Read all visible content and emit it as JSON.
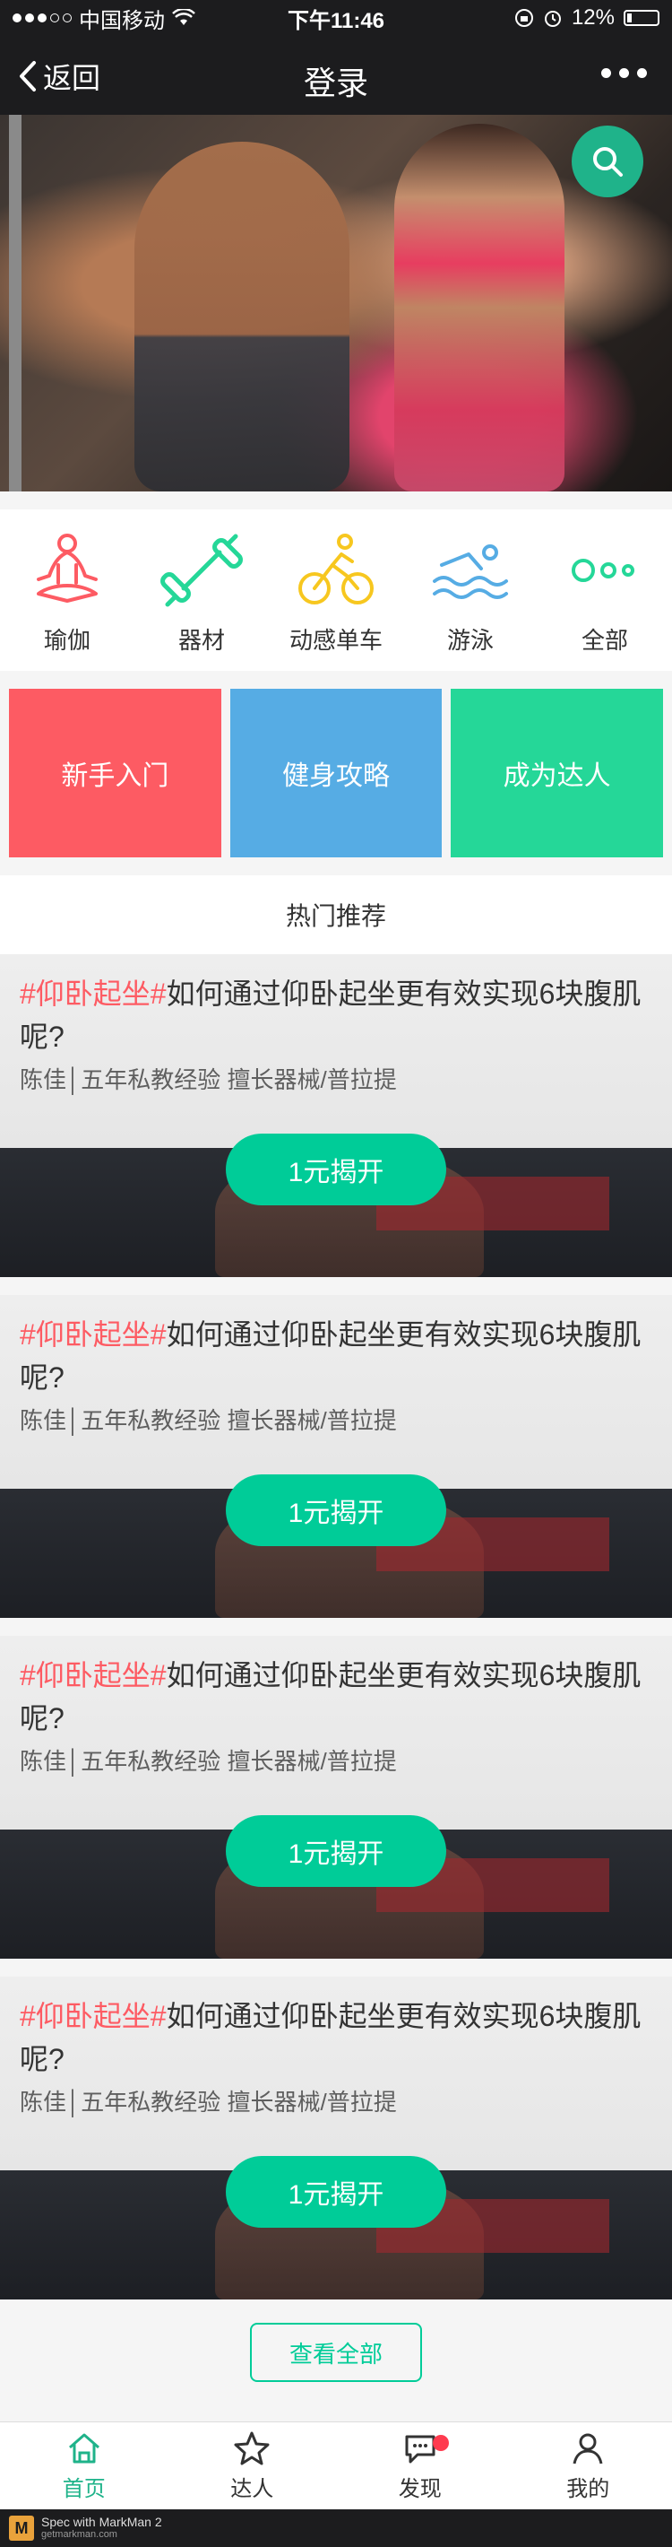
{
  "status_bar": {
    "carrier": "中国移动",
    "time": "下午11:46",
    "battery": "12%"
  },
  "nav": {
    "back_label": "返回",
    "title": "登录",
    "more_icon": "more-dots-icon"
  },
  "hero": {
    "search_icon": "search-icon"
  },
  "categories": [
    {
      "label": "瑜伽",
      "icon": "yoga-icon",
      "color": "#fd5b63"
    },
    {
      "label": "器材",
      "icon": "dumbbell-icon",
      "color": "#25d798"
    },
    {
      "label": "动感单车",
      "icon": "cycling-icon",
      "color": "#f7c71f"
    },
    {
      "label": "游泳",
      "icon": "swimming-icon",
      "color": "#56ace4"
    },
    {
      "label": "全部",
      "icon": "all-dots-icon",
      "color": "#25d798"
    }
  ],
  "tiles": [
    {
      "label": "新手入门",
      "color": "#fd5b63"
    },
    {
      "label": "健身攻略",
      "color": "#56ace4"
    },
    {
      "label": "成为达人",
      "color": "#25d798"
    }
  ],
  "hot_header": {
    "label": "热门推荐"
  },
  "articles": [
    {
      "tag": "#仰卧起坐#",
      "title": "如何通过仰卧起坐更有效实现6块腹肌呢?",
      "meta": "陈佳│五年私教经验 擅长器械/普拉提",
      "button": "1元揭开"
    },
    {
      "tag": "#仰卧起坐#",
      "title": "如何通过仰卧起坐更有效实现6块腹肌呢?",
      "meta": "陈佳│五年私教经验 擅长器械/普拉提",
      "button": "1元揭开"
    },
    {
      "tag": "#仰卧起坐#",
      "title": "如何通过仰卧起坐更有效实现6块腹肌呢?",
      "meta": "陈佳│五年私教经验 擅长器械/普拉提",
      "button": "1元揭开"
    },
    {
      "tag": "#仰卧起坐#",
      "title": "如何通过仰卧起坐更有效实现6块腹肌呢?",
      "meta": "陈佳│五年私教经验 擅长器械/普拉提",
      "button": "1元揭开"
    }
  ],
  "view_all": {
    "label": "查看全部"
  },
  "tab_bar": [
    {
      "label": "首页",
      "icon": "home-icon",
      "active": true
    },
    {
      "label": "达人",
      "icon": "star-icon",
      "active": false
    },
    {
      "label": "发现",
      "icon": "chat-bubble-icon",
      "active": false
    },
    {
      "label": "我的",
      "icon": "user-icon",
      "active": false
    }
  ],
  "footer": {
    "title": "Spec with MarkMan 2",
    "subtitle": "getmarkman.com",
    "logo": "M"
  },
  "colors": {
    "accent": "#00cc98",
    "tag": "#fd5b63",
    "meta": "#5f5f5f",
    "text": "#333333"
  }
}
